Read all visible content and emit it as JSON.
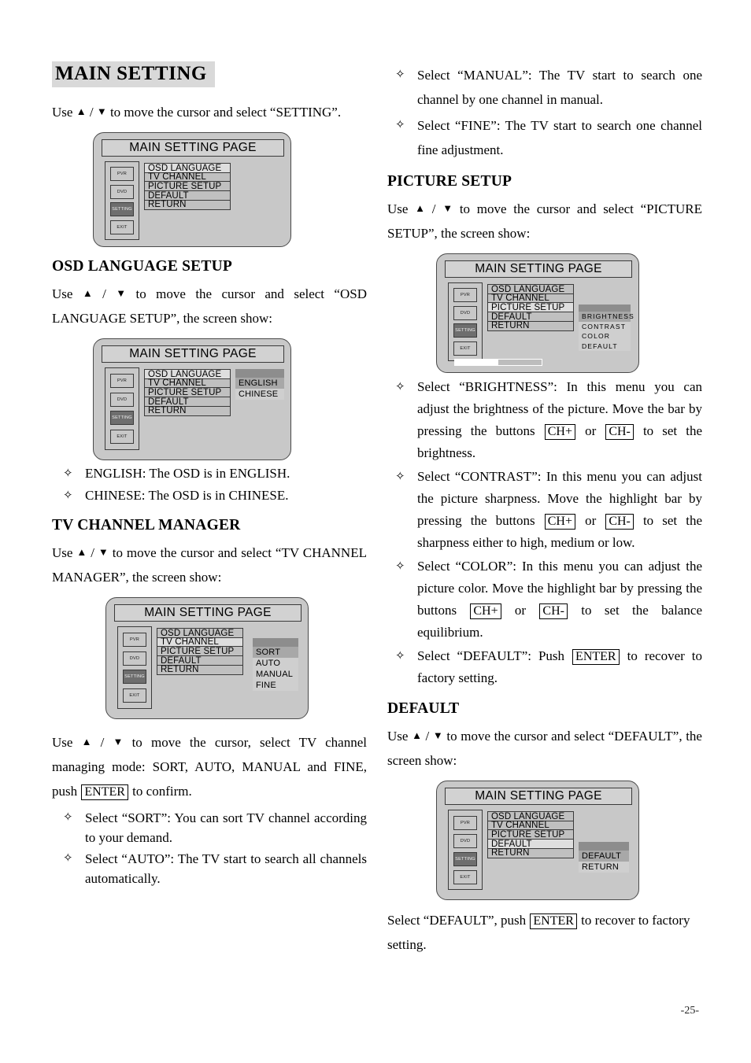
{
  "page": {
    "number": "-25-"
  },
  "left_column": {
    "banner_title": "MAIN SETTING",
    "intro": {
      "before": "Use ",
      "after": " to move the cursor and select “SETTING”."
    },
    "diagram_main": {
      "title": "MAIN SETTING PAGE",
      "side_buttons": [
        "PVR",
        "DVD",
        "SETTING",
        "EXIT"
      ],
      "side_selected": "SETTING",
      "menu_items": [
        "OSD LANGUAGE",
        "TV CHANNEL",
        "PICTURE SETUP",
        "DEFAULT",
        "RETURN"
      ],
      "menu_selected": "OSD LANGUAGE",
      "submenu": []
    },
    "osd_language": {
      "heading": "OSD LANGUAGE SETUP",
      "para_before": "Use ",
      "para_after": " to move the cursor and select “OSD LANGUAGE SETUP”, the screen show:",
      "diagram": {
        "title": "MAIN SETTING PAGE",
        "side_buttons": [
          "PVR",
          "DVD",
          "SETTING",
          "EXIT"
        ],
        "side_selected": "SETTING",
        "menu_items": [
          "OSD LANGUAGE",
          "TV CHANNEL",
          "PICTURE SETUP",
          "DEFAULT",
          "RETURN"
        ],
        "menu_selected": "OSD LANGUAGE",
        "submenu": [
          "ENGLISH",
          "CHINESE"
        ],
        "submenu_selected": "ENGLISH"
      },
      "bullets": [
        "ENGLISH: The OSD is in ENGLISH.",
        "CHINESE: The OSD is in CHINESE."
      ]
    },
    "tv_channel": {
      "heading": "TV CHANNEL MANAGER",
      "para_before": "Use ",
      "para_after": " to move the cursor and select “TV CHANNEL MANAGER”, the screen show:",
      "diagram": {
        "title": "MAIN SETTING PAGE",
        "side_buttons": [
          "PVR",
          "DVD",
          "SETTING",
          "EXIT"
        ],
        "side_selected": "SETTING",
        "menu_items": [
          "OSD LANGUAGE",
          "TV CHANNEL",
          "PICTURE SETUP",
          "DEFAULT",
          "RETURN"
        ],
        "menu_selected": "TV CHANNEL",
        "submenu": [
          "SORT",
          "AUTO",
          "MANUAL",
          "FINE"
        ],
        "submenu_selected": "SORT"
      },
      "para2_before": "Use ",
      "para2_mid": " to move the cursor, select TV channel managing mode: SORT, AUTO, MANUAL and FINE, push ",
      "para2_key": "ENTER",
      "para2_after": " to confirm.",
      "bullets": [
        "Select “SORT”: You can sort TV channel according to your demand.",
        "Select “AUTO”: The TV start to search all channels automatically."
      ]
    }
  },
  "right_column": {
    "top_bullets": [
      "Select “MANUAL”: The TV start to search one channel by one channel in manual.",
      "Select “FINE”: The TV start to search one channel fine adjustment."
    ],
    "picture_setup": {
      "heading": "PICTURE SETUP",
      "para_before": "Use ",
      "para_after": " to move the cursor and select “PICTURE SETUP”, the screen show:",
      "diagram": {
        "title": "MAIN SETTING PAGE",
        "side_buttons": [
          "PVR",
          "DVD",
          "SETTING",
          "EXIT"
        ],
        "side_selected": "SETTING",
        "menu_items": [
          "OSD LANGUAGE",
          "TV CHANNEL",
          "PICTURE SETUP",
          "DEFAULT",
          "RETURN"
        ],
        "menu_selected": "PICTURE SETUP",
        "submenu": [
          "BRIGHTNESS",
          "CONTRAST",
          "COLOR",
          "DEFAULT"
        ],
        "submenu_selected": "BRIGHTNESS",
        "progress_bar_percent": 50
      },
      "bullets": [
        {
          "parts": [
            {
              "t": "Select “BRIGHTNESS”: In this menu you can adjust the brightness of the picture. Move the bar by pressing the buttons "
            },
            {
              "k": "CH+"
            },
            {
              "t": " or "
            },
            {
              "k": "CH-"
            },
            {
              "t": " to set the brightness."
            }
          ]
        },
        {
          "parts": [
            {
              "t": "Select “CONTRAST”: In this menu you can adjust the picture sharpness. Move the highlight bar by pressing the buttons "
            },
            {
              "k": "CH+"
            },
            {
              "t": " or "
            },
            {
              "k": "CH-"
            },
            {
              "t": " to set the sharpness either to high, medium or low."
            }
          ]
        },
        {
          "parts": [
            {
              "t": "Select “COLOR”: In this menu you can adjust the picture color. Move the highlight bar by pressing the buttons "
            },
            {
              "k": "CH+"
            },
            {
              "t": " or "
            },
            {
              "k": "CH-"
            },
            {
              "t": " to set the balance equilibrium."
            }
          ]
        },
        {
          "parts": [
            {
              "t": "Select “DEFAULT”: Push "
            },
            {
              "k": "ENTER"
            },
            {
              "t": " to recover to factory setting."
            }
          ]
        }
      ]
    },
    "default_section": {
      "heading": "DEFAULT",
      "para_before": "Use ",
      "para_after": " to move the cursor and select “DEFAULT”, the screen show:",
      "diagram": {
        "title": "MAIN SETTING PAGE",
        "side_buttons": [
          "PVR",
          "DVD",
          "SETTING",
          "EXIT"
        ],
        "side_selected": "SETTING",
        "menu_items": [
          "OSD LANGUAGE",
          "TV CHANNEL",
          "PICTURE SETUP",
          "DEFAULT",
          "RETURN"
        ],
        "menu_selected": "DEFAULT",
        "submenu": [
          "DEFAULT",
          "RETURN"
        ],
        "submenu_selected": "DEFAULT"
      },
      "closing_before": "Select “DEFAULT”, push ",
      "closing_key": "ENTER",
      "closing_after": " to recover to factory setting."
    }
  },
  "colors": {
    "banner_bg": "#d9d9d9",
    "tv_body": "#c8c8c8",
    "menu_item_bg": "#c0c0c0",
    "menu_item_sel": "#dedede",
    "submenu_bg": "#cfcfcf",
    "submenu_head": "#8d8d8d",
    "submenu_sel": "#a8a8a8",
    "side_sel": "#6e6e6e"
  }
}
